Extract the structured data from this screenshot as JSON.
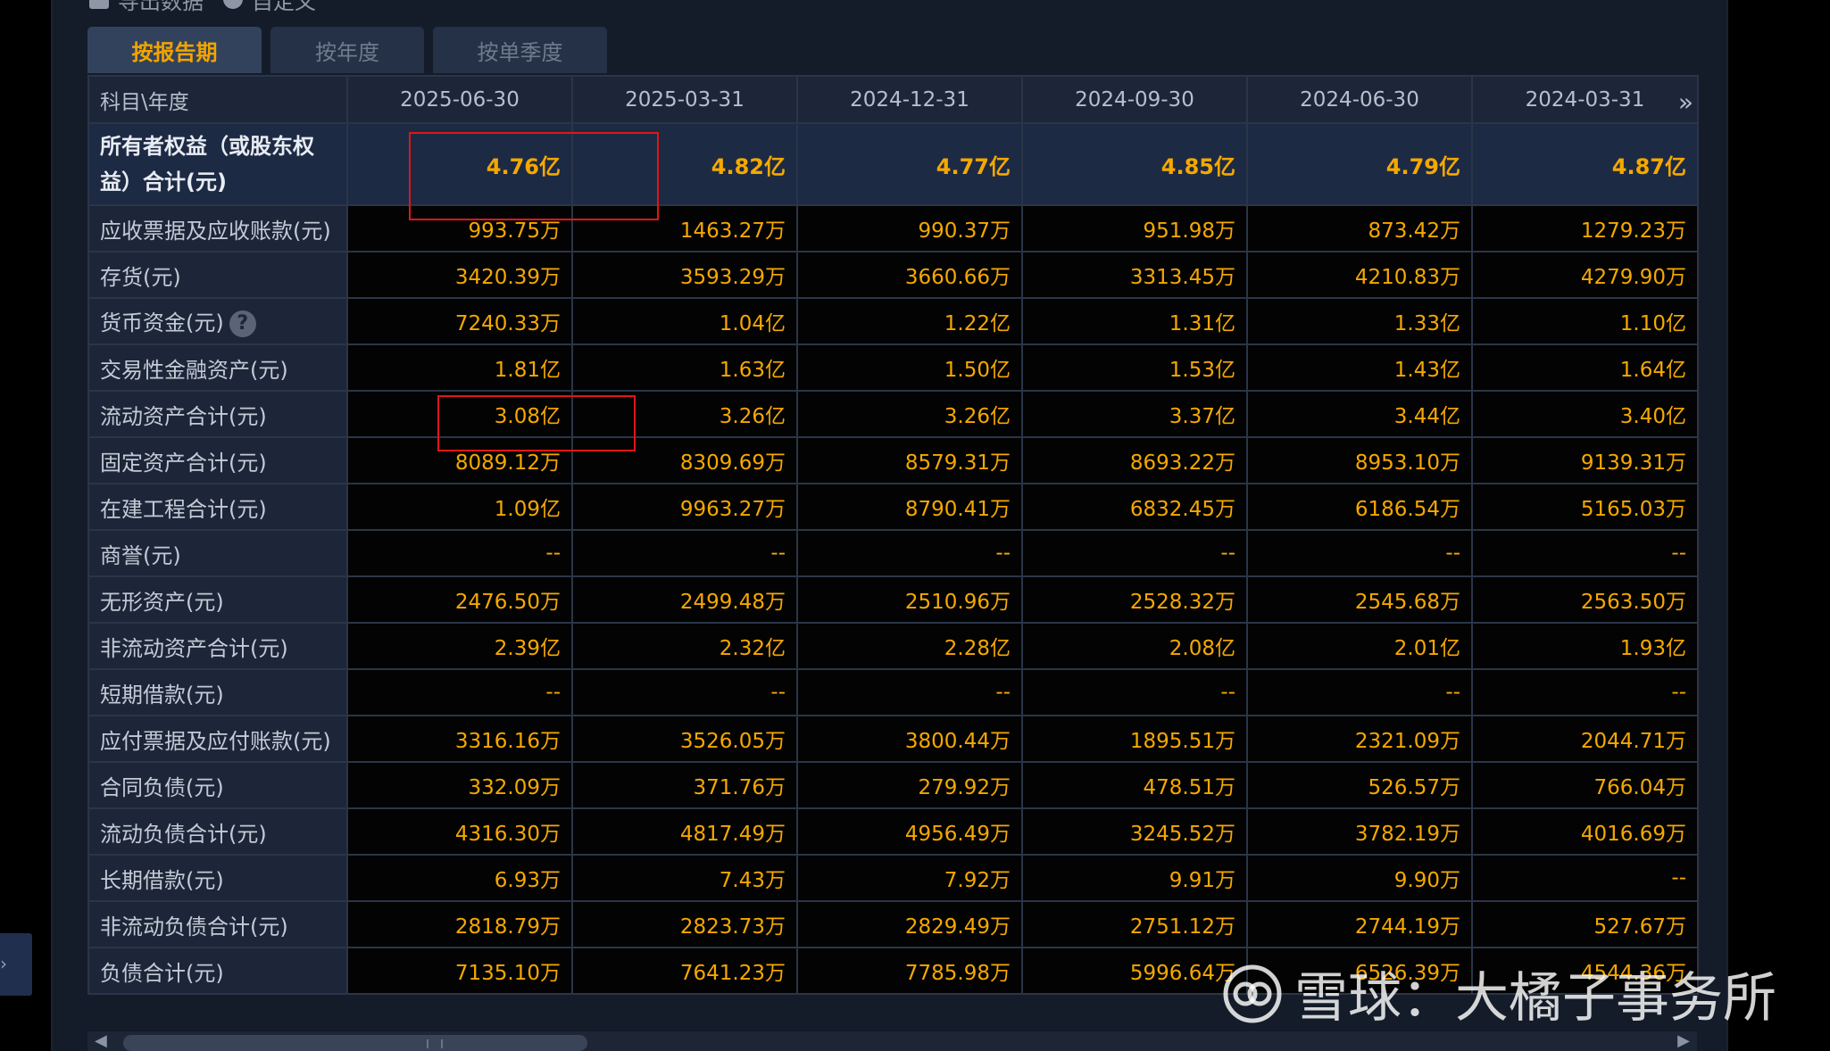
{
  "toolbar": {
    "export": "导出数据",
    "customize": "自定义"
  },
  "tabs": [
    "按报告期",
    "按年度",
    "按单季度"
  ],
  "header": [
    "科目\\年度",
    "2025-06-30",
    "2025-03-31",
    "2024-12-31",
    "2024-09-30",
    "2024-06-30",
    "2024-03-31"
  ],
  "rows": [
    {
      "label": "所有者权益（或股东权益）合计(元)",
      "values": [
        "4.76亿",
        "4.82亿",
        "4.77亿",
        "4.85亿",
        "4.79亿",
        "4.87亿"
      ]
    },
    {
      "label": "应收票据及应收账款(元)",
      "values": [
        "993.75万",
        "1463.27万",
        "990.37万",
        "951.98万",
        "873.42万",
        "1279.23万"
      ]
    },
    {
      "label": "存货(元)",
      "values": [
        "3420.39万",
        "3593.29万",
        "3660.66万",
        "3313.45万",
        "4210.83万",
        "4279.90万"
      ]
    },
    {
      "label": "货币资金(元)",
      "values": [
        "7240.33万",
        "1.04亿",
        "1.22亿",
        "1.31亿",
        "1.33亿",
        "1.10亿"
      ]
    },
    {
      "label": "交易性金融资产(元)",
      "values": [
        "1.81亿",
        "1.63亿",
        "1.50亿",
        "1.53亿",
        "1.43亿",
        "1.64亿"
      ]
    },
    {
      "label": "流动资产合计(元)",
      "values": [
        "3.08亿",
        "3.26亿",
        "3.26亿",
        "3.37亿",
        "3.44亿",
        "3.40亿"
      ]
    },
    {
      "label": "固定资产合计(元)",
      "values": [
        "8089.12万",
        "8309.69万",
        "8579.31万",
        "8693.22万",
        "8953.10万",
        "9139.31万"
      ]
    },
    {
      "label": "在建工程合计(元)",
      "values": [
        "1.09亿",
        "9963.27万",
        "8790.41万",
        "6832.45万",
        "6186.54万",
        "5165.03万"
      ]
    },
    {
      "label": "商誉(元)",
      "values": [
        "--",
        "--",
        "--",
        "--",
        "--",
        "--"
      ]
    },
    {
      "label": "无形资产(元)",
      "values": [
        "2476.50万",
        "2499.48万",
        "2510.96万",
        "2528.32万",
        "2545.68万",
        "2563.50万"
      ]
    },
    {
      "label": "非流动资产合计(元)",
      "values": [
        "2.39亿",
        "2.32亿",
        "2.28亿",
        "2.08亿",
        "2.01亿",
        "1.93亿"
      ]
    },
    {
      "label": "短期借款(元)",
      "values": [
        "--",
        "--",
        "--",
        "--",
        "--",
        "--"
      ]
    },
    {
      "label": "应付票据及应付账款(元)",
      "values": [
        "3316.16万",
        "3526.05万",
        "3800.44万",
        "1895.51万",
        "2321.09万",
        "2044.71万"
      ]
    },
    {
      "label": "合同负债(元)",
      "values": [
        "332.09万",
        "371.76万",
        "279.92万",
        "478.51万",
        "526.57万",
        "766.04万"
      ]
    },
    {
      "label": "流动负债合计(元)",
      "values": [
        "4316.30万",
        "4817.49万",
        "4956.49万",
        "3245.52万",
        "3782.19万",
        "4016.69万"
      ]
    },
    {
      "label": "长期借款(元)",
      "values": [
        "6.93万",
        "7.43万",
        "7.92万",
        "9.91万",
        "9.90万",
        "--"
      ]
    },
    {
      "label": "非流动负债合计(元)",
      "values": [
        "2818.79万",
        "2823.73万",
        "2829.49万",
        "2751.12万",
        "2744.19万",
        "527.67万"
      ]
    },
    {
      "label": "负债合计(元)",
      "values": [
        "7135.10万",
        "7641.23万",
        "7785.98万",
        "5996.64万",
        "6526.39万",
        "4544.36万"
      ]
    }
  ],
  "help_icon": "?",
  "watermark": "雪球：大橘子事务所",
  "colors": {
    "value": "#f5a800",
    "highlight_box": "#e01616",
    "active_tab_text": "#f2a400"
  }
}
